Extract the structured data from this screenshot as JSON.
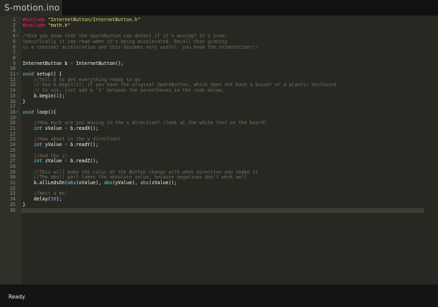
{
  "tab": {
    "title": "S-motion.ino"
  },
  "status": {
    "text": "Ready."
  },
  "colors": {
    "background": "#272822",
    "comment": "#75715e",
    "preprocessor": "#f92672",
    "string": "#e6db74",
    "keyword": "#66d9ef",
    "number": "#ae81ff",
    "plain": "#f8f8f2"
  },
  "code": [
    {
      "n": "1",
      "tokens": [
        [
          "pre",
          "#include "
        ],
        [
          "str",
          "\"InternetButton/InternetButton.h\""
        ]
      ]
    },
    {
      "n": "2",
      "tokens": [
        [
          "pre",
          "#include "
        ],
        [
          "str",
          "\"math.h\""
        ]
      ]
    },
    {
      "n": "3",
      "tokens": []
    },
    {
      "n": "4",
      "fold": true,
      "tokens": [
        [
          "comment",
          "/*Did you know that the SparkButton can detect if it's moving? It's true!"
        ]
      ]
    },
    {
      "n": "5",
      "tokens": [
        [
          "comment",
          "Specifically it can read when it's being accelerated. Recall that gravity"
        ]
      ]
    },
    {
      "n": "6",
      "tokens": [
        [
          "comment",
          "is a constant acceleration and this becomes very useful- you know the orientation!*/"
        ]
      ]
    },
    {
      "n": "7",
      "tokens": []
    },
    {
      "n": "8",
      "tokens": []
    },
    {
      "n": "9",
      "tokens": [
        [
          "plain",
          "InternetButton b "
        ],
        [
          "op",
          "="
        ],
        [
          "plain",
          " InternetButton();"
        ]
      ]
    },
    {
      "n": "10",
      "tokens": []
    },
    {
      "n": "11",
      "fold": true,
      "tokens": [
        [
          "kw",
          "void"
        ],
        [
          "plain",
          " setup() {"
        ]
      ]
    },
    {
      "n": "12",
      "tokens": [
        [
          "plain",
          "    "
        ],
        [
          "comment",
          "//Tell b to get everything ready to go"
        ]
      ]
    },
    {
      "n": "13",
      "tokens": [
        [
          "plain",
          "    "
        ],
        [
          "comment",
          "// Use b.begin(1); if you have the original SparkButton, which does not have a buzzer or a plastic enclosure"
        ]
      ]
    },
    {
      "n": "14",
      "tokens": [
        [
          "plain",
          "    "
        ],
        [
          "comment",
          "// to use, just add a '1' between the parentheses in the code below."
        ]
      ]
    },
    {
      "n": "15",
      "tokens": [
        [
          "plain",
          "    b.begin("
        ],
        [
          "num",
          "1"
        ],
        [
          "plain",
          ");"
        ]
      ]
    },
    {
      "n": "16",
      "tokens": [
        [
          "plain",
          "}"
        ]
      ]
    },
    {
      "n": "17",
      "tokens": []
    },
    {
      "n": "18",
      "fold": true,
      "tokens": [
        [
          "kw",
          "void"
        ],
        [
          "plain",
          " loop(){"
        ]
      ]
    },
    {
      "n": "19",
      "tokens": []
    },
    {
      "n": "20",
      "tokens": [
        [
          "plain",
          "    "
        ],
        [
          "comment",
          "//How much are you moving in the x direction? (look at the white text on the board)"
        ]
      ]
    },
    {
      "n": "21",
      "tokens": [
        [
          "plain",
          "    "
        ],
        [
          "kw",
          "int"
        ],
        [
          "plain",
          " xValue "
        ],
        [
          "op",
          "="
        ],
        [
          "plain",
          " b.readX();"
        ]
      ]
    },
    {
      "n": "22",
      "tokens": []
    },
    {
      "n": "23",
      "tokens": [
        [
          "plain",
          "    "
        ],
        [
          "comment",
          "//How about in the y direction?"
        ]
      ]
    },
    {
      "n": "24",
      "tokens": [
        [
          "plain",
          "    "
        ],
        [
          "kw",
          "int"
        ],
        [
          "plain",
          " yValue "
        ],
        [
          "op",
          "="
        ],
        [
          "plain",
          " b.readY();"
        ]
      ]
    },
    {
      "n": "25",
      "tokens": []
    },
    {
      "n": "26",
      "tokens": [
        [
          "plain",
          "    "
        ],
        [
          "comment",
          "//And the z!"
        ]
      ]
    },
    {
      "n": "27",
      "tokens": [
        [
          "plain",
          "    "
        ],
        [
          "kw",
          "int"
        ],
        [
          "plain",
          " zValue "
        ],
        [
          "op",
          "="
        ],
        [
          "plain",
          " b.readZ();"
        ]
      ]
    },
    {
      "n": "28",
      "tokens": []
    },
    {
      "n": "29",
      "tokens": [
        [
          "plain",
          "    "
        ],
        [
          "comment",
          "//This will make the color of the Button change with what direction you shake it"
        ]
      ]
    },
    {
      "n": "30",
      "tokens": [
        [
          "plain",
          "    "
        ],
        [
          "comment",
          "//The abs() part takes the absolute value, because negatives don't work well"
        ]
      ]
    },
    {
      "n": "31",
      "tokens": [
        [
          "plain",
          "    b.allLedsOn("
        ],
        [
          "builtin",
          "abs"
        ],
        [
          "plain",
          "(xValue), "
        ],
        [
          "builtin",
          "abs"
        ],
        [
          "plain",
          "(yValue), "
        ],
        [
          "builtin",
          "abs"
        ],
        [
          "plain",
          "(zValue));"
        ]
      ]
    },
    {
      "n": "32",
      "tokens": []
    },
    {
      "n": "33",
      "tokens": [
        [
          "plain",
          "    "
        ],
        [
          "comment",
          "//Wait a mo'"
        ]
      ]
    },
    {
      "n": "34",
      "tokens": [
        [
          "plain",
          "    delay("
        ],
        [
          "num",
          "50"
        ],
        [
          "plain",
          ");"
        ]
      ]
    },
    {
      "n": "35",
      "tokens": [
        [
          "plain",
          "}"
        ]
      ]
    },
    {
      "n": "36",
      "active": true,
      "tokens": []
    }
  ]
}
